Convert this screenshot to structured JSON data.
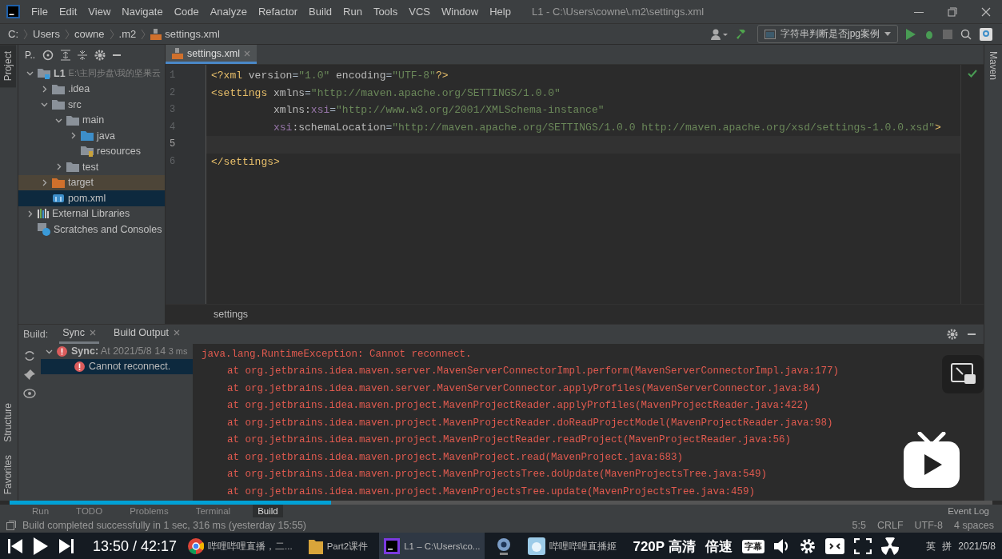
{
  "menu_bar": {
    "items": [
      "File",
      "Edit",
      "View",
      "Navigate",
      "Code",
      "Analyze",
      "Refactor",
      "Build",
      "Run",
      "Tools",
      "VCS",
      "Window",
      "Help"
    ],
    "title": "L1 - C:\\Users\\cowne\\.m2\\settings.xml"
  },
  "navigation_bar": {
    "breadcrumbs": [
      "C:",
      "Users",
      "cowne",
      ".m2",
      "settings.xml"
    ],
    "run_configuration": "字符串判断是否jpg案例"
  },
  "left_stripe": {
    "top": [
      {
        "label": "Project",
        "selected": true
      }
    ],
    "bottom": [
      {
        "label": "Structure",
        "selected": false
      },
      {
        "label": "Favorites",
        "selected": false
      }
    ]
  },
  "right_stripe": [
    {
      "label": "Maven",
      "selected": false
    }
  ],
  "project_panel": {
    "title": "P..",
    "tree": [
      {
        "label": "L1",
        "path": "E:\\主同步盘\\我的坚果云",
        "kind": "module",
        "expanded": true,
        "selected": false,
        "children": [
          {
            "label": ".idea",
            "kind": "folder",
            "expanded": false,
            "selected": false
          },
          {
            "label": "src",
            "kind": "folder",
            "expanded": true,
            "selected": false,
            "children": [
              {
                "label": "main",
                "kind": "folder",
                "expanded": true,
                "selected": false,
                "children": [
                  {
                    "label": "java",
                    "kind": "source",
                    "expanded": false,
                    "selected": false
                  },
                  {
                    "label": "resources",
                    "kind": "resources",
                    "selected": false
                  }
                ]
              },
              {
                "label": "test",
                "kind": "folder",
                "expanded": false,
                "selected": false
              }
            ]
          },
          {
            "label": "target",
            "kind": "excluded",
            "expanded": false,
            "selected": false
          },
          {
            "label": "pom.xml",
            "kind": "maven",
            "selected": true
          }
        ]
      },
      {
        "label": "External Libraries",
        "kind": "libraries",
        "expanded": false,
        "selected": false
      },
      {
        "label": "Scratches and Consoles",
        "kind": "scratches",
        "selected": false
      }
    ]
  },
  "editor": {
    "tab": "settings.xml",
    "lines": [
      {
        "number": "1",
        "current": false,
        "tokens": [
          {
            "text": "<?xml ",
            "kind": "tag"
          },
          {
            "text": "version",
            "kind": "attr"
          },
          {
            "text": "=",
            "kind": "plain"
          },
          {
            "text": "\"1.0\"",
            "kind": "value"
          },
          {
            "text": " encoding",
            "kind": "attr"
          },
          {
            "text": "=",
            "kind": "plain"
          },
          {
            "text": "\"UTF-8\"",
            "kind": "value"
          },
          {
            "text": "?>",
            "kind": "tag"
          }
        ]
      },
      {
        "number": "2",
        "current": false,
        "tokens": [
          {
            "text": "<settings",
            "kind": "tag"
          },
          {
            "text": " xmlns",
            "kind": "attr"
          },
          {
            "text": "=",
            "kind": "plain"
          },
          {
            "text": "\"http://maven.apache.org/SETTINGS/1.0.0\"",
            "kind": "value"
          }
        ]
      },
      {
        "number": "3",
        "current": false,
        "tokens": [
          {
            "text": "          xmlns:",
            "kind": "attr"
          },
          {
            "text": "xsi",
            "kind": "ns"
          },
          {
            "text": "=",
            "kind": "plain"
          },
          {
            "text": "\"http://www.w3.org/2001/XMLSchema-instance\"",
            "kind": "value"
          }
        ]
      },
      {
        "number": "4",
        "current": false,
        "tokens": [
          {
            "text": "          xsi",
            "kind": "ns"
          },
          {
            "text": ":schemaLocation",
            "kind": "attr"
          },
          {
            "text": "=",
            "kind": "plain"
          },
          {
            "text": "\"http://maven.apache.org/SETTINGS/1.0.0 http://maven.apache.org/xsd/settings-1.0.0.xsd\"",
            "kind": "value"
          },
          {
            "text": ">",
            "kind": "tag"
          }
        ]
      },
      {
        "number": "5",
        "current": true
      },
      {
        "number": "6",
        "current": false,
        "tokens": [
          {
            "text": "</settings>",
            "kind": "tag"
          }
        ]
      }
    ],
    "breadcrumb": "settings"
  },
  "build_panel": {
    "label": "Build:",
    "tabs": [
      {
        "label": "Sync",
        "selected": true
      },
      {
        "label": "Build Output",
        "selected": false
      }
    ],
    "tree": [
      {
        "label": "Sync:",
        "detail": "At 2021/5/8 14",
        "time": "3 ms",
        "expanded": true,
        "selected": false,
        "children": [
          {
            "label": "Cannot reconnect.",
            "selected": true
          }
        ]
      }
    ],
    "console": [
      {
        "kind": "exception",
        "text": "java.lang.RuntimeException: Cannot reconnect."
      },
      {
        "kind": "frame",
        "text": "at org.jetbrains.idea.maven.server.MavenServerConnectorImpl.perform(MavenServerConnectorImpl.java:177)"
      },
      {
        "kind": "frame",
        "text": "at org.jetbrains.idea.maven.server.MavenServerConnector.applyProfiles(MavenServerConnector.java:84)"
      },
      {
        "kind": "frame",
        "text": "at org.jetbrains.idea.maven.project.MavenProjectReader.applyProfiles(MavenProjectReader.java:422)"
      },
      {
        "kind": "frame",
        "text": "at org.jetbrains.idea.maven.project.MavenProjectReader.doReadProjectModel(MavenProjectReader.java:98)"
      },
      {
        "kind": "frame",
        "text": "at org.jetbrains.idea.maven.project.MavenProjectReader.readProject(MavenProjectReader.java:56)"
      },
      {
        "kind": "frame",
        "text": "at org.jetbrains.idea.maven.project.MavenProject.read(MavenProject.java:683)"
      },
      {
        "kind": "frame",
        "text": "at org.jetbrains.idea.maven.project.MavenProjectsTree.doUpdate(MavenProjectsTree.java:549)"
      },
      {
        "kind": "frame",
        "text": "at org.jetbrains.idea.maven.project.MavenProjectsTree.update(MavenProjectsTree.java:459)"
      }
    ]
  },
  "tool_window_bar": {
    "tabs": [
      {
        "label": "Run",
        "selected": false
      },
      {
        "label": "TODO",
        "selected": false
      },
      {
        "label": "Problems",
        "selected": false
      },
      {
        "label": "Terminal",
        "selected": false
      },
      {
        "label": "Build",
        "selected": true
      }
    ],
    "event_log": "Event Log"
  },
  "status_bar": {
    "message": "Build completed successfully in 1 sec, 316 ms (yesterday 15:55)",
    "items": [
      "5:5",
      "CRLF",
      "UTF-8",
      "4 spaces"
    ]
  },
  "video_player": {
    "progress": {
      "level": 0.327
    },
    "time": "13:50 / 42:17",
    "quality": "720P 高清",
    "speed": "倍速",
    "subtitle": "字幕"
  },
  "taskbar": {
    "items": [
      {
        "kind": "chrome",
        "label": "哔哩哔哩直播，二...",
        "selected": false
      },
      {
        "kind": "folder",
        "label": "Part2课件",
        "selected": false
      },
      {
        "kind": "intellij",
        "label": "L1 – C:\\Users\\co...",
        "selected": true
      },
      {
        "kind": "webcam",
        "selected": false
      },
      {
        "kind": "live",
        "label": "哔哩哔哩直播姬",
        "selected": false
      }
    ],
    "ime": "英",
    "ime_mode": "拼",
    "date": "2021/5/8"
  }
}
